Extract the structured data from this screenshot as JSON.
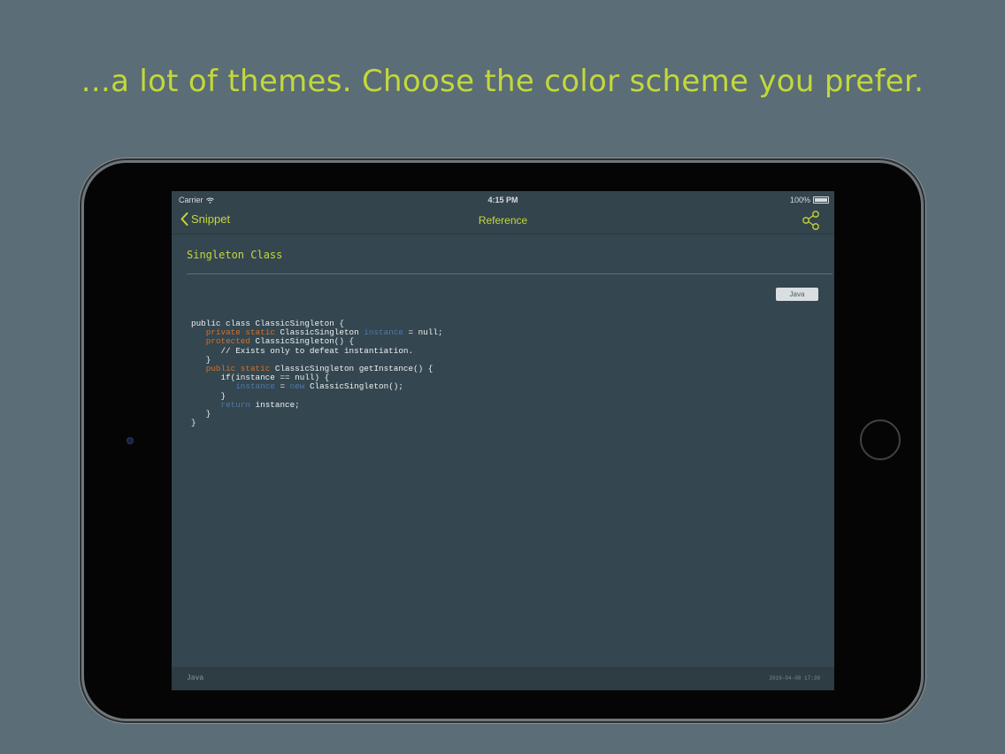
{
  "headline": "...a lot of themes. Choose the color scheme you prefer.",
  "colors": {
    "accent": "#c3d83b",
    "background": "#5b6d76",
    "screen": "#34444c",
    "keyword_orange": "#d4712a",
    "keyword_blue": "#4f79a8"
  },
  "statusbar": {
    "carrier": "Carrier",
    "time": "4:15 PM",
    "battery": "100%"
  },
  "navbar": {
    "back_label": "Snippet",
    "title": "Reference",
    "share_icon": "share-icon"
  },
  "snippet": {
    "title": "Singleton Class",
    "language_badge": "Java",
    "code_lines": [
      [
        {
          "t": "public class ClassicSingleton {",
          "c": ""
        }
      ],
      [
        {
          "t": "   ",
          "c": ""
        },
        {
          "t": "private static",
          "c": "o"
        },
        {
          "t": " ClassicSingleton ",
          "c": ""
        },
        {
          "t": "instance",
          "c": "b"
        },
        {
          "t": " = null;",
          "c": ""
        }
      ],
      [
        {
          "t": "   ",
          "c": ""
        },
        {
          "t": "protected",
          "c": "o"
        },
        {
          "t": " ClassicSingleton() {",
          "c": ""
        }
      ],
      [
        {
          "t": "      // Exists only to defeat instantiation.",
          "c": ""
        }
      ],
      [
        {
          "t": "   }",
          "c": ""
        }
      ],
      [
        {
          "t": "   ",
          "c": ""
        },
        {
          "t": "public static",
          "c": "o"
        },
        {
          "t": " ClassicSingleton getInstance() {",
          "c": ""
        }
      ],
      [
        {
          "t": "      if(instance == null) {",
          "c": ""
        }
      ],
      [
        {
          "t": "         ",
          "c": ""
        },
        {
          "t": "instance",
          "c": "b"
        },
        {
          "t": " = ",
          "c": ""
        },
        {
          "t": "new",
          "c": "b"
        },
        {
          "t": " ClassicSingleton();",
          "c": ""
        }
      ],
      [
        {
          "t": "      }",
          "c": ""
        }
      ],
      [
        {
          "t": "      ",
          "c": ""
        },
        {
          "t": "return",
          "c": "b"
        },
        {
          "t": " instance;",
          "c": ""
        }
      ],
      [
        {
          "t": "   }",
          "c": ""
        }
      ],
      [
        {
          "t": "}",
          "c": ""
        }
      ]
    ]
  },
  "footer": {
    "language": "Java",
    "date": "2016-04-08 17:39"
  }
}
